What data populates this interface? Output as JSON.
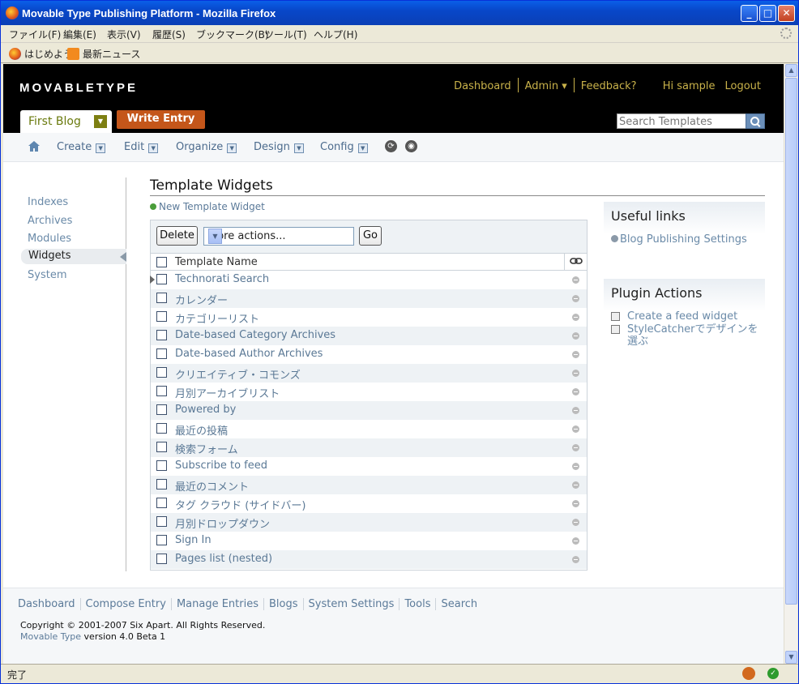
{
  "window": {
    "title": "Movable Type Publishing Platform - Mozilla Firefox"
  },
  "menubar": [
    "ファイル(F)",
    "編集(E)",
    "表示(V)",
    "履歴(S)",
    "ブックマーク(B)",
    "ツール(T)",
    "ヘルプ(H)"
  ],
  "bookmarks": [
    "はじめよう",
    "最新ニュース"
  ],
  "header": {
    "logo": "MOVABLETYPE",
    "links": {
      "dashboard": "Dashboard",
      "admin": "Admin ▾",
      "feedback": "Feedback?",
      "greeting": "Hi sample",
      "logout": "Logout"
    },
    "blog_name": "First Blog",
    "write_entry": "Write Entry",
    "search_placeholder": "Search Templates"
  },
  "nav": {
    "create": "Create",
    "edit": "Edit",
    "organize": "Organize",
    "design": "Design",
    "config": "Config"
  },
  "sidebar": {
    "items": [
      "Indexes",
      "Archives",
      "Modules",
      "Widgets",
      "System"
    ],
    "active": "Widgets"
  },
  "main": {
    "title": "Template Widgets",
    "new_link": "New Template Widget",
    "delete_label": "Delete",
    "more_actions": "More actions...",
    "go_label": "Go",
    "column_header": "Template Name",
    "rows": [
      "Technorati Search",
      "カレンダー",
      "カテゴリーリスト",
      "Date-based Category Archives",
      "Date-based Author Archives",
      "クリエイティブ・コモンズ",
      "月別アーカイブリスト",
      "Powered by",
      "最近の投稿",
      "検索フォーム",
      "Subscribe to feed",
      "最近のコメント",
      "タグ クラウド (サイドバー)",
      "月別ドロップダウン",
      "Sign In",
      "Pages list (nested)"
    ]
  },
  "useful_links": {
    "heading": "Useful links",
    "link": "Blog Publishing Settings"
  },
  "plugin_actions": {
    "heading": "Plugin Actions",
    "link1": "Create a feed widget",
    "link2": "StyleCatcherでデザインを選ぶ"
  },
  "footer": {
    "links": [
      "Dashboard",
      "Compose Entry",
      "Manage Entries",
      "Blogs",
      "System Settings",
      "Tools",
      "Search"
    ],
    "copyright": "Copyright © 2001-2007 Six Apart. All Rights Reserved.",
    "version_product": "Movable Type",
    "version_text": " version 4.0 Beta 1"
  },
  "status": "完了"
}
